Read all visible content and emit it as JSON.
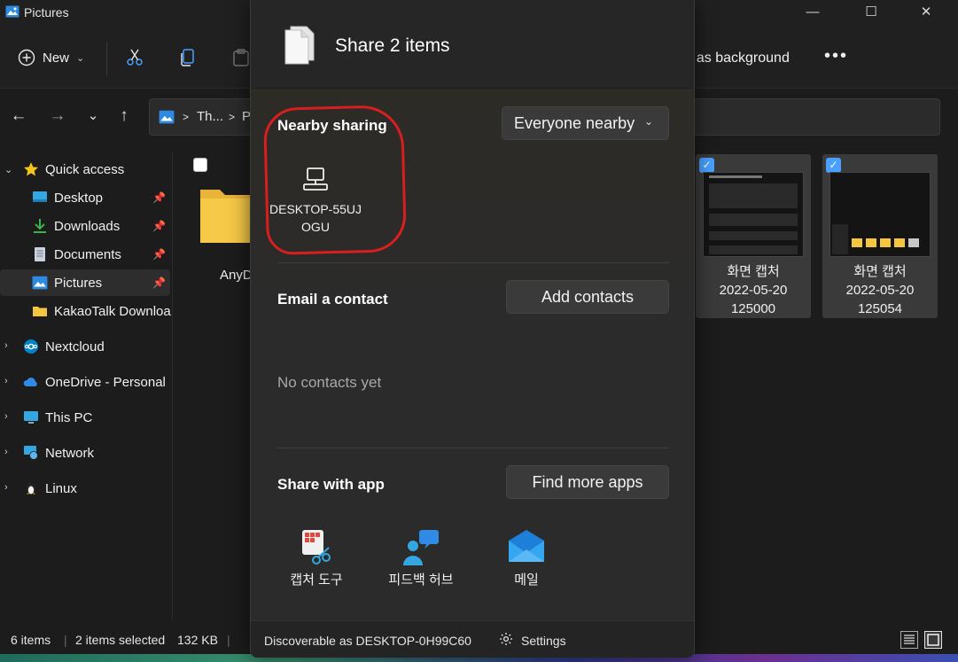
{
  "window": {
    "title": "Pictures",
    "minimize_glyph": "—",
    "maximize_glyph": "☐",
    "close_glyph": "✕"
  },
  "toolbar": {
    "new_label": "New",
    "new_chevron": "⌄",
    "set_background_label": "t as background",
    "more_label": "•••"
  },
  "address": {
    "back": "←",
    "forward": "→",
    "recent": "⌄",
    "up": "↑",
    "crumbs": [
      "Th...",
      "Pi"
    ],
    "separator": ">"
  },
  "sidebar": {
    "items": [
      {
        "label": "Quick access",
        "icon": "star-icon"
      },
      {
        "label": "Desktop",
        "icon": "desktop-icon"
      },
      {
        "label": "Downloads",
        "icon": "download-icon"
      },
      {
        "label": "Documents",
        "icon": "document-icon"
      },
      {
        "label": "Pictures",
        "icon": "pictures-icon"
      },
      {
        "label": "KakaoTalk Downloa",
        "icon": "folder-icon"
      },
      {
        "label": "Nextcloud",
        "icon": "nextcloud-icon"
      },
      {
        "label": "OneDrive - Personal",
        "icon": "onedrive-icon"
      },
      {
        "label": "This PC",
        "icon": "pc-icon"
      },
      {
        "label": "Network",
        "icon": "network-icon"
      },
      {
        "label": "Linux",
        "icon": "linux-icon"
      }
    ]
  },
  "content": {
    "folder_name": "AnyD",
    "images": [
      {
        "line1": "화면 캡처",
        "line2": "2022-05-20",
        "line3": "125000"
      },
      {
        "line1": "화면 캡처",
        "line2": "2022-05-20",
        "line3": "125054"
      }
    ]
  },
  "statusbar": {
    "item_count": "6 items",
    "selected": "2 items selected",
    "size": "132 KB",
    "sep": "|"
  },
  "share": {
    "title": "Share 2 items",
    "nearby_title": "Nearby sharing",
    "nearby_dropdown": "Everyone nearby",
    "device_name_line1": "DESKTOP-55UJ",
    "device_name_line2": "OGU",
    "email_title": "Email a contact",
    "add_contacts": "Add contacts",
    "no_contacts": "No contacts yet",
    "app_title": "Share with app",
    "find_apps": "Find more apps",
    "apps": [
      {
        "name": "캡처 도구",
        "icon": "snipping-tool-icon"
      },
      {
        "name": "피드백 허브",
        "icon": "feedback-hub-icon"
      },
      {
        "name": "메일",
        "icon": "mail-icon"
      }
    ],
    "discoverable": "Discoverable as DESKTOP-0H99C60",
    "settings": "Settings",
    "accent_color": "#d81e1e"
  }
}
